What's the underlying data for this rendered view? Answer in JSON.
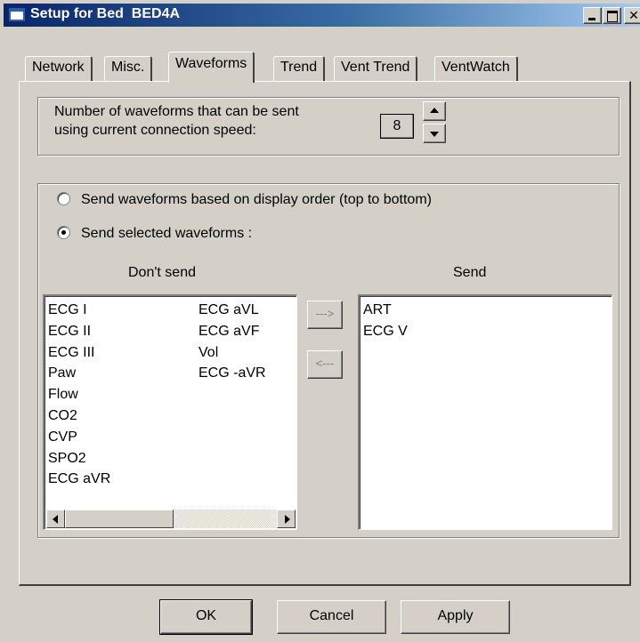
{
  "window": {
    "title": "Setup for Bed  BED4A",
    "controls": {
      "minimize": "minimize-icon",
      "maximize": "maximize-icon",
      "close": "✕"
    }
  },
  "tabs": [
    {
      "label": "Network",
      "active": false
    },
    {
      "label": "Misc.",
      "active": false
    },
    {
      "label": "Waveforms",
      "active": true
    },
    {
      "label": "Trend",
      "active": false
    },
    {
      "label": "Vent Trend",
      "active": false
    },
    {
      "label": "VentWatch",
      "active": false
    }
  ],
  "waveform_count": {
    "label_line1": "Number of waveforms that can be sent",
    "label_line2": "using current connection speed:",
    "value": "8"
  },
  "send_mode": {
    "option_display_order": "Send waveforms based on display order (top to bottom)",
    "option_selected": "Send selected waveforms :",
    "selected": "option_selected"
  },
  "dont_send": {
    "header": "Don't send",
    "col1": [
      "ECG I",
      "ECG II",
      "ECG III",
      "Paw",
      "Flow",
      "CO2",
      "CVP",
      "SPO2",
      "ECG aVR"
    ],
    "col2": [
      "ECG aVL",
      "ECG aVF",
      "Vol",
      "ECG -aVR"
    ]
  },
  "send": {
    "header": "Send",
    "items": [
      "ART",
      "ECG V"
    ]
  },
  "move_buttons": {
    "add": "--->",
    "remove": "<---"
  },
  "footer": {
    "ok": "OK",
    "cancel": "Cancel",
    "apply": "Apply"
  }
}
